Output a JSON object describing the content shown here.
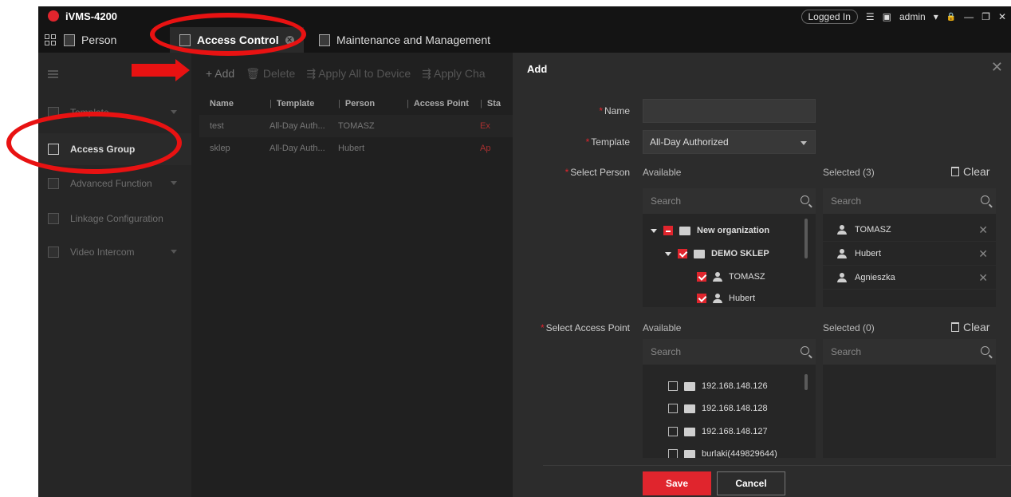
{
  "app": {
    "title": "iVMS-4200"
  },
  "titlebar": {
    "login_status": "Logged In",
    "user": "admin",
    "list_glyph": "☰",
    "chart_glyph": "▣",
    "lock_glyph": "🔒",
    "min_glyph": "—",
    "restore_glyph": "❐",
    "close_glyph": "✕"
  },
  "tabs": [
    {
      "label": "Person"
    },
    {
      "label": "Access Control",
      "close": "✕"
    },
    {
      "label": "Maintenance and Management"
    }
  ],
  "sidebar": {
    "items": [
      {
        "label": "Template"
      },
      {
        "label": "Access Group"
      },
      {
        "label": "Advanced Function"
      },
      {
        "label": "Linkage Configuration"
      },
      {
        "label": "Video Intercom"
      }
    ]
  },
  "toolbar": {
    "add": "+ Add",
    "delete": "🗑 Delete",
    "apply_all": "⇶ Apply All to Device",
    "apply_changes": "⇶ Apply Cha"
  },
  "table": {
    "headers": [
      "Name",
      "Template",
      "Person",
      "Access Point",
      "Sta"
    ],
    "rows": [
      {
        "name": "test",
        "template": "All-Day Auth...",
        "person": "TOMASZ",
        "status": "Ex"
      },
      {
        "name": "sklep",
        "template": "All-Day Auth...",
        "person": "Hubert",
        "status": "Ap"
      }
    ]
  },
  "dialog": {
    "title": "Add",
    "close": "✕",
    "name_label": "Name",
    "name_value": "",
    "template_label": "Template",
    "template_value": "All-Day Authorized",
    "select_person_label": "Select Person",
    "available_label": "Available",
    "selected_person_label": "Selected (3)",
    "clear_label": "Clear",
    "search_placeholder": "Search",
    "person_tree": [
      {
        "label": "New organization"
      },
      {
        "label": "DEMO SKLEP"
      },
      {
        "label": "TOMASZ"
      },
      {
        "label": "Hubert"
      }
    ],
    "selected_persons": [
      "TOMASZ",
      "Hubert",
      "Agnieszka"
    ],
    "remove_glyph": "✕",
    "select_access_label": "Select Access Point",
    "available_access_label": "Available",
    "selected_access_label": "Selected (0)",
    "clear_access_label": "Clear",
    "access_points": [
      "192.168.148.126",
      "192.168.148.128",
      "192.168.148.127",
      "burlaki(449829644)"
    ],
    "save": "Save",
    "cancel": "Cancel"
  },
  "colors": {
    "accent": "#e0252d",
    "annotation": "#e81212"
  }
}
